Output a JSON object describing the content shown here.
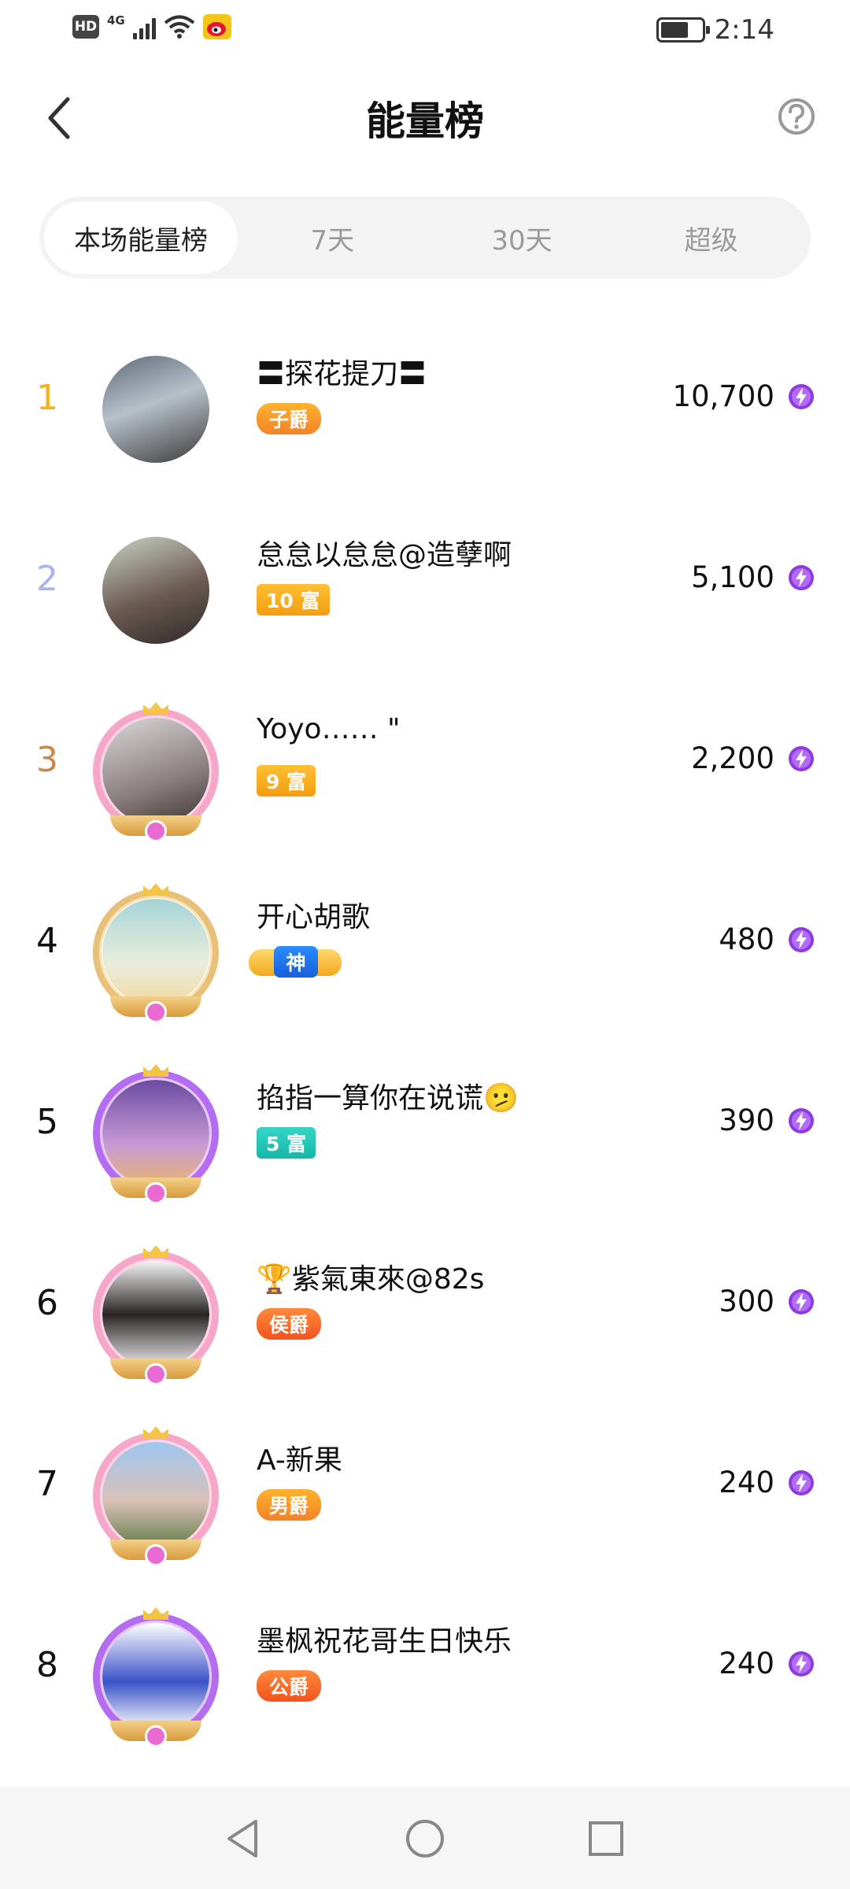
{
  "status_bar": {
    "hd": "HD",
    "network": "4G",
    "time": "2:14"
  },
  "header": {
    "title": "能量榜",
    "back_icon": "chevron-left-icon",
    "help_icon": "question-circle-icon"
  },
  "tabs": [
    {
      "label": "本场能量榜",
      "active": true
    },
    {
      "label": "7天",
      "active": false
    },
    {
      "label": "30天",
      "active": false
    },
    {
      "label": "超级",
      "active": false
    }
  ],
  "rankings": [
    {
      "rank": "1",
      "rank_color": "#f3b11b",
      "name": "〓探花提刀〓",
      "badge": "子爵",
      "badge_style": "noble-orange",
      "score": "10,700",
      "frame": "none",
      "avatar_bg": "linear-gradient(160deg,#5e6a7a,#b7c0c9 45%,#3c3a3a)"
    },
    {
      "rank": "2",
      "rank_color": "#a9b3f0",
      "name": "怠怠以怠怠@造孽啊",
      "badge": "10 富",
      "badge_style": "rich",
      "score": "5,100",
      "frame": "none",
      "avatar_bg": "linear-gradient(160deg,#c9d2c4,#6b5a52 55%,#2f2a2a)"
    },
    {
      "rank": "3",
      "rank_color": "#c9884c",
      "name": "Yoyo…… \"",
      "badge": "9 富",
      "badge_style": "rich",
      "score": "2,200",
      "frame": "pink",
      "avatar_bg": "linear-gradient(160deg,#d9d9d9,#8a7d7d 60%,#3b3434)"
    },
    {
      "rank": "4",
      "rank_color": "#111111",
      "name": "开心胡歌",
      "badge": "神",
      "badge_style": "god",
      "score": "480",
      "frame": "gold",
      "avatar_bg": "linear-gradient(180deg,#a7d4d8,#e8eddc 60%,#f2d9a0)"
    },
    {
      "rank": "5",
      "rank_color": "#111111",
      "name": "掐指一算你在说谎🫤",
      "badge": "5 富",
      "badge_style": "rich-teal",
      "score": "390",
      "frame": "violet",
      "avatar_bg": "linear-gradient(180deg,#6b4aa0,#c79ad6 60%,#e8b46c)"
    },
    {
      "rank": "6",
      "rank_color": "#111111",
      "name": "🏆紫氣東來@82s",
      "badge": "侯爵",
      "badge_style": "noble-red",
      "score": "300",
      "frame": "pink",
      "avatar_bg": "linear-gradient(180deg,#f4f4f4,#2a2525 50%,#eeeeee)"
    },
    {
      "rank": "7",
      "rank_color": "#111111",
      "name": "A-新果",
      "badge": "男爵",
      "badge_style": "noble-orange",
      "score": "240",
      "frame": "pink",
      "avatar_bg": "linear-gradient(180deg,#9fc6ef,#d9c1b8 55%,#5e7a45)"
    },
    {
      "rank": "8",
      "rank_color": "#111111",
      "name": "墨枫祝花哥生日快乐",
      "badge": "公爵",
      "badge_style": "noble-red",
      "score": "240",
      "frame": "violet",
      "avatar_bg": "linear-gradient(180deg,#ffffff,#3b52c8 55%,#ffffff)"
    }
  ],
  "nav": {
    "back_icon": "triangle-back-icon",
    "home_icon": "circle-home-icon",
    "recents_icon": "square-recents-icon"
  }
}
